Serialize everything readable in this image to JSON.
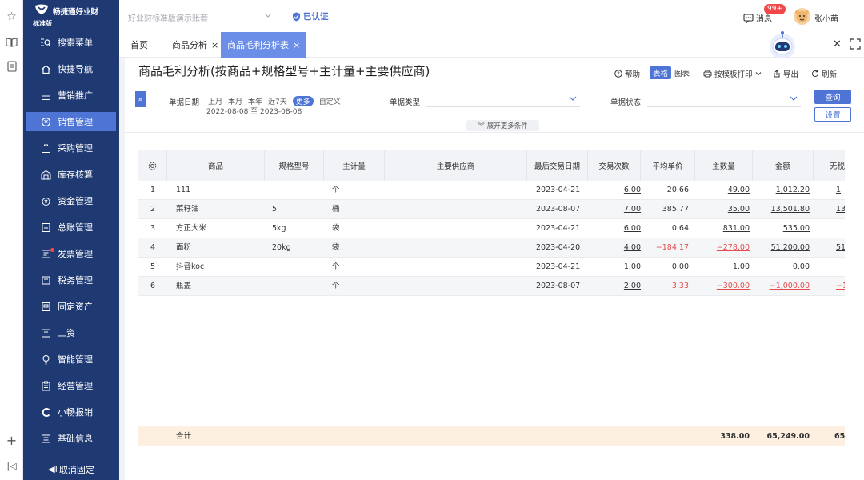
{
  "brand": {
    "name": "畅捷通好业财",
    "edition": "标准版"
  },
  "topbar": {
    "account": "好业财标准版演示账套",
    "certified": "已认证",
    "messages_label": "消息",
    "messages_badge": "99+",
    "username": "张小萌"
  },
  "sidebar": {
    "items": [
      {
        "label": "搜索菜单",
        "icon": "search-menu-icon"
      },
      {
        "label": "快捷导航",
        "icon": "home-icon"
      },
      {
        "label": "营销推广",
        "icon": "gift-icon"
      },
      {
        "label": "销售管理",
        "icon": "sales-icon",
        "active": true
      },
      {
        "label": "采购管理",
        "icon": "purchase-icon"
      },
      {
        "label": "库存核算",
        "icon": "warehouse-icon"
      },
      {
        "label": "资金管理",
        "icon": "money-icon"
      },
      {
        "label": "总账管理",
        "icon": "ledger-icon"
      },
      {
        "label": "发票管理",
        "icon": "invoice-icon"
      },
      {
        "label": "税务管理",
        "icon": "tax-icon"
      },
      {
        "label": "固定资产",
        "icon": "asset-icon"
      },
      {
        "label": "工资",
        "icon": "salary-icon"
      },
      {
        "label": "智能管理",
        "icon": "bulb-icon"
      },
      {
        "label": "经营管理",
        "icon": "clipboard-icon"
      },
      {
        "label": "小畅报销",
        "icon": "reimburse-icon"
      },
      {
        "label": "基础信息",
        "icon": "info-icon"
      }
    ],
    "unpin_label": "取消固定"
  },
  "tabs": [
    {
      "label": "首页",
      "closable": false
    },
    {
      "label": "商品分析",
      "closable": true
    },
    {
      "label": "商品毛利分析表",
      "closable": true,
      "active": true
    }
  ],
  "page": {
    "title": "商品毛利分析(按商品+规格型号+主计量+主要供应商)",
    "help": "帮助",
    "view_table": "表格",
    "view_chart": "图表",
    "print": "按模板打印",
    "export": "导出",
    "refresh": "刷新"
  },
  "filters": {
    "date_label": "单据日期",
    "quick": [
      "上月",
      "本月",
      "本年",
      "近7天",
      "更多",
      "自定义"
    ],
    "quick_active": "更多",
    "date_range": "2022-08-08 至 2023-08-08",
    "type_label": "单据类型",
    "status_label": "单据状态",
    "query": "查询",
    "settings": "设置",
    "more": "展开更多条件"
  },
  "table": {
    "headers": [
      "商品",
      "规格型号",
      "主计量",
      "主要供应商",
      "最后交易日期",
      "交易次数",
      "平均单价",
      "主数量",
      "金额",
      "无税"
    ],
    "rows": [
      {
        "no": "1",
        "product": "111",
        "spec": "",
        "unit": "个",
        "supplier": "",
        "date": "2023-04-21",
        "count": "6.00",
        "price": "20.66",
        "qty": "49.00",
        "amount": "1,012.20",
        "extra": "1",
        "neg": false
      },
      {
        "no": "2",
        "product": "菜籽油",
        "spec": "5",
        "unit": "桶",
        "supplier": "",
        "date": "2023-08-07",
        "count": "7.00",
        "price": "385.77",
        "qty": "35.00",
        "amount": "13,501.80",
        "extra": "13",
        "neg": false
      },
      {
        "no": "3",
        "product": "方正大米",
        "spec": "5kg",
        "unit": "袋",
        "supplier": "",
        "date": "2023-04-21",
        "count": "6.00",
        "price": "0.64",
        "qty": "831.00",
        "amount": "535.00",
        "extra": "",
        "neg": false
      },
      {
        "no": "4",
        "product": "面粉",
        "spec": "20kg",
        "unit": "袋",
        "supplier": "",
        "date": "2023-04-20",
        "count": "4.00",
        "price": "−184.17",
        "qty": "−278.00",
        "amount": "51,200.00",
        "extra": "51,",
        "neg": true,
        "amount_neg": false
      },
      {
        "no": "5",
        "product": "抖音koc",
        "spec": "",
        "unit": "个",
        "supplier": "",
        "date": "2023-04-21",
        "count": "1.00",
        "price": "0.00",
        "qty": "1.00",
        "amount": "0.00",
        "extra": "",
        "neg": false
      },
      {
        "no": "6",
        "product": "瓶盖",
        "spec": "",
        "unit": "个",
        "supplier": "",
        "date": "2023-08-07",
        "count": "2.00",
        "price": "3.33",
        "qty": "−300.00",
        "amount": "−1,000.00",
        "extra": "−1,",
        "neg": true,
        "amount_neg": true
      }
    ],
    "footer": {
      "label": "合计",
      "qty": "338.00",
      "amount": "65,249.00",
      "extra": "65,"
    }
  }
}
